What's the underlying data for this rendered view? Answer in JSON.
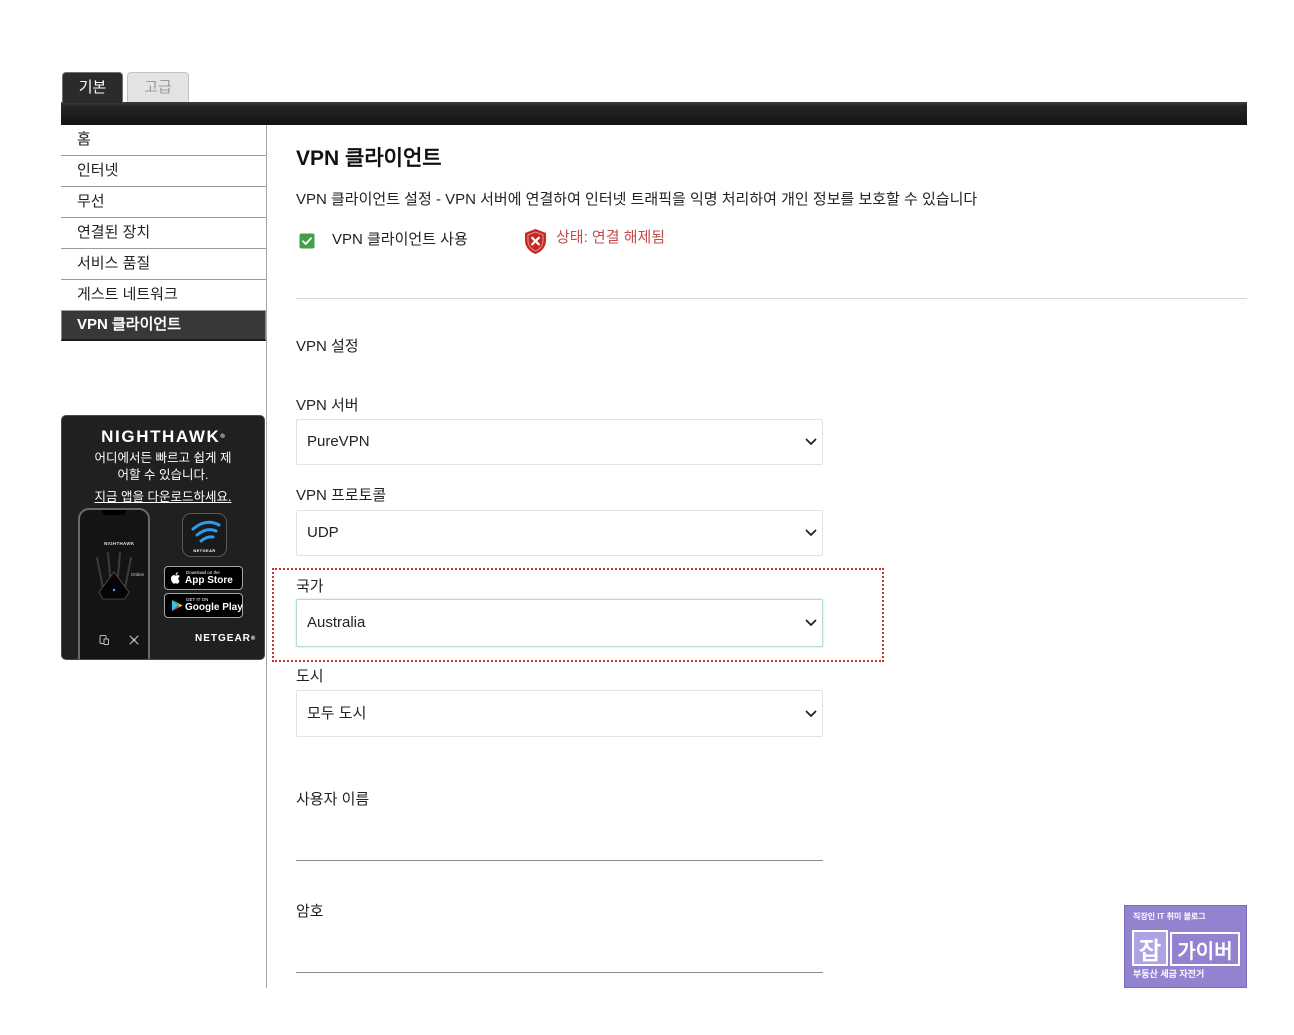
{
  "tabs": [
    {
      "label": "기본",
      "active": true
    },
    {
      "label": "고급",
      "active": false
    }
  ],
  "sidebar": {
    "items": [
      {
        "label": "홈",
        "active": false
      },
      {
        "label": "인터넷",
        "active": false
      },
      {
        "label": "무선",
        "active": false
      },
      {
        "label": "연결된 장치",
        "active": false
      },
      {
        "label": "서비스 품질",
        "active": false
      },
      {
        "label": "게스트 네트워크",
        "active": false
      },
      {
        "label": "VPN 클라이언트",
        "active": true
      }
    ]
  },
  "ad": {
    "brand": "NIGHTHAWK",
    "reg_mark": "®",
    "tagline": "어디에서든 빠르고 쉽게 제어할 수 있습니다.",
    "cta": "지금 앱을 다운로드하세요.",
    "phone_screen": {
      "app_title": "NIGHTHAWK",
      "router_status": "Online"
    },
    "app_icon_label": "NETGEAR",
    "app_store": {
      "small": "Download on the",
      "large": "App Store",
      "icon": "apple-icon"
    },
    "google_play": {
      "small": "GET IT ON",
      "large": "Google Play",
      "icon": "google-play-icon"
    },
    "logo": "NETGEAR"
  },
  "main": {
    "title": "VPN 클라이언트",
    "description": "VPN 클라이언트 설정 - VPN 서버에 연결하여 인터넷 트래픽을 익명 처리하여 개인 정보를 보호할 수 있습니다",
    "enable": {
      "label": "VPN 클라이언트 사용",
      "checked": true
    },
    "status": {
      "text": "상태: 연결 해제됨",
      "icon": "shield-x-icon"
    },
    "section_title": "VPN 설정",
    "fields": {
      "server": {
        "label": "VPN 서버",
        "value": "PureVPN"
      },
      "protocol": {
        "label": "VPN 프로토콜",
        "value": "UDP"
      },
      "country": {
        "label": "국가",
        "value": "Australia",
        "highlighted": true
      },
      "city": {
        "label": "도시",
        "value": "모두 도시"
      },
      "username": {
        "label": "사용자 이름"
      },
      "password": {
        "label": "암호"
      }
    }
  },
  "watermark": {
    "top": "직장인 IT 취미 블로그",
    "badge": "잡",
    "name": "가이버",
    "bottom": "부동산 세금 자전거"
  },
  "colors": {
    "active_nav": "#383838",
    "checkbox": "#43a047",
    "status_red": "#c94a4a",
    "shield_red": "#c62828",
    "highlight_border": "#c0392b",
    "focus_border": "#b3dada",
    "watermark_purple": "#9282cf"
  }
}
